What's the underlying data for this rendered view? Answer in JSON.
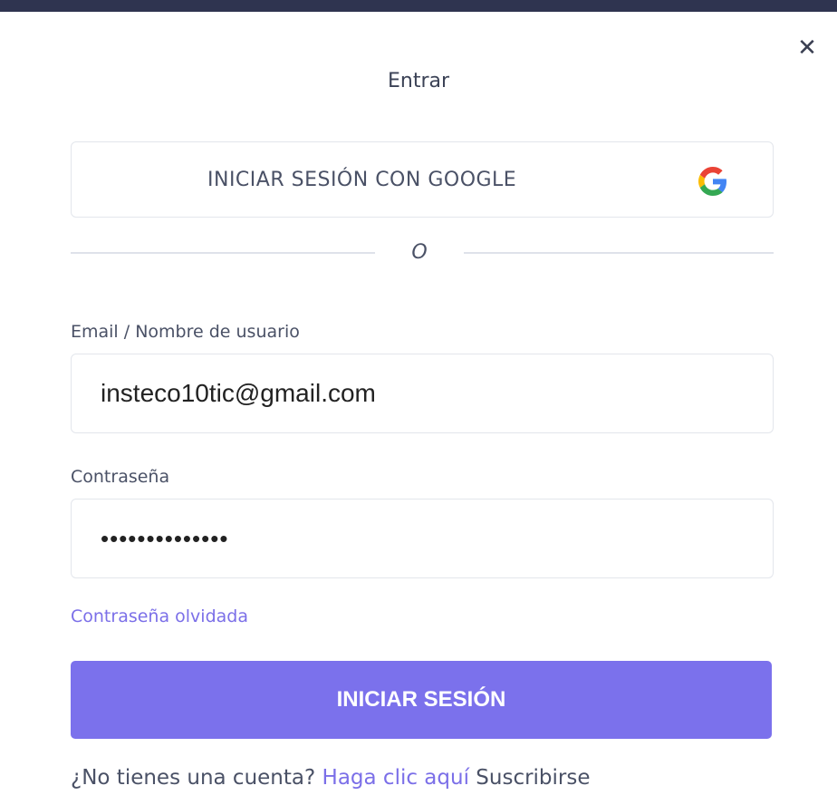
{
  "dialog": {
    "title": "Entrar",
    "close_icon": "close-icon"
  },
  "google": {
    "label": "INICIAR SESIÓN CON GOOGLE",
    "icon": "google-icon",
    "colors": {
      "blue": "#4285F4",
      "red": "#EA4335",
      "yellow": "#FBBC05",
      "green": "#34A853"
    }
  },
  "divider": {
    "text": "O"
  },
  "email": {
    "label": "Email / Nombre de usuario",
    "value": "insteco10tic@gmail.com"
  },
  "password": {
    "label": "Contraseña",
    "value": "••••••••••••••"
  },
  "forgot": {
    "label": "Contraseña olvidada"
  },
  "login": {
    "label": "INICIAR SESIÓN",
    "color": "#7b71ec"
  },
  "signup": {
    "prompt": "¿No tienes una cuenta?",
    "link": "Haga clic aquí",
    "suffix": "Suscribirse"
  },
  "colors": {
    "topbar": "#2f3450",
    "link": "#7b6fe8",
    "text": "#4a5166"
  }
}
